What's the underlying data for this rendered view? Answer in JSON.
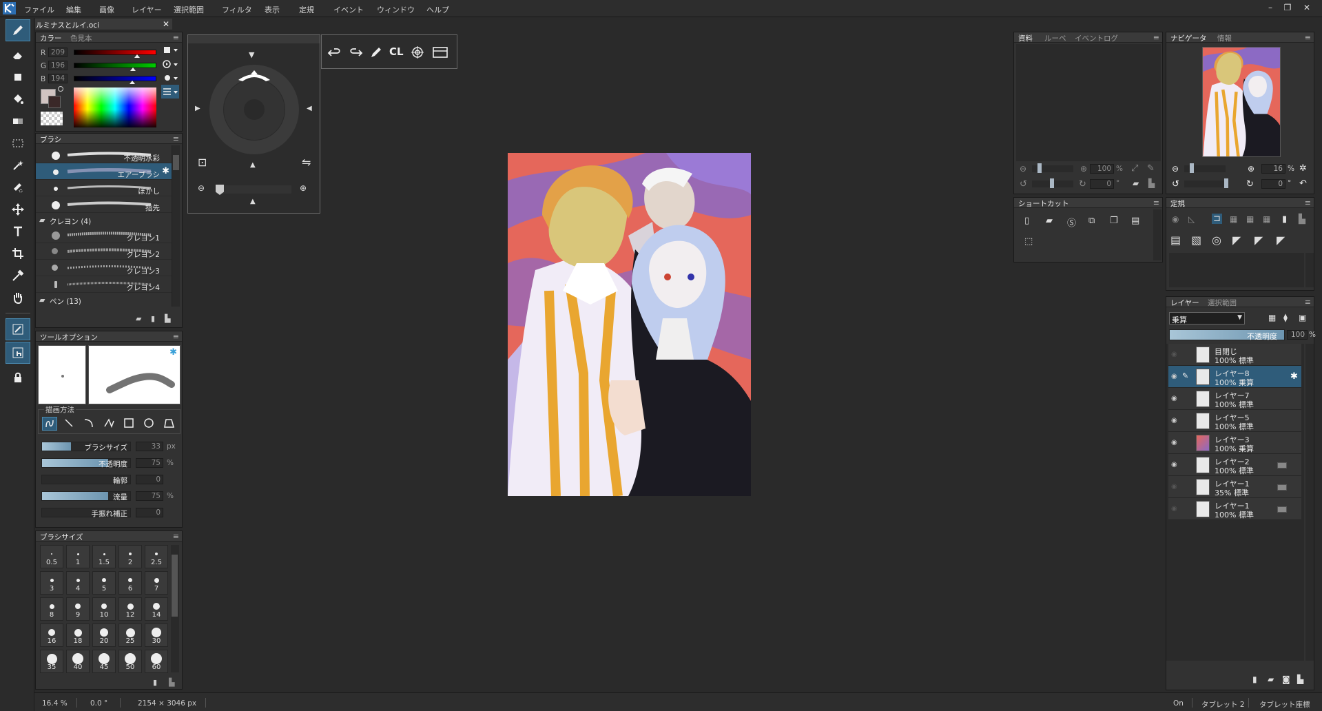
{
  "menu": [
    "ファイル",
    "編集",
    "画像",
    "レイヤー",
    "選択範囲",
    "フィルタ",
    "表示",
    "定規",
    "イベント",
    "ウィンドウ",
    "ヘルプ"
  ],
  "window_controls": [
    "–",
    "❐",
    "✕"
  ],
  "doc_tab": {
    "name": "ルミナスとルイ.oci",
    "close": "✕"
  },
  "color_panel": {
    "tabs": [
      "カラー",
      "色見本"
    ],
    "r_label": "R",
    "r_value": "209",
    "g_label": "G",
    "g_value": "196",
    "b_label": "B",
    "b_value": "194",
    "current_color": "#d1c4c2",
    "menu_glyph": "≡"
  },
  "brush_panel": {
    "title": "ブラシ",
    "items": [
      {
        "name": "不透明水彩"
      },
      {
        "name": "エアーブラシ"
      },
      {
        "name": "ぼかし"
      },
      {
        "name": "指先"
      }
    ],
    "group_crayon": "クレヨン (4)",
    "crayon_items": [
      {
        "name": "クレヨン1"
      },
      {
        "name": "クレヨン2"
      },
      {
        "name": "クレヨン3"
      },
      {
        "name": "クレヨン4"
      }
    ],
    "group_pen": "ペン (13)"
  },
  "tool_options": {
    "title": "ツールオプション",
    "draw_method_label": "描画方法",
    "brush_size_label": "ブラシサイズ",
    "brush_size_value": "33",
    "brush_size_unit": "px",
    "brush_size_level": 0.33,
    "opacity_label": "不透明度",
    "opacity_value": "75",
    "opacity_unit": "%",
    "opacity_level": 0.75,
    "outline_label": "輪郭",
    "outline_value": "0",
    "flow_label": "流量",
    "flow_value": "75",
    "flow_unit": "%",
    "flow_level": 0.75,
    "stabilizer_label": "手振れ補正",
    "stabilizer_value": "0"
  },
  "brush_size_panel": {
    "title": "ブラシサイズ",
    "sizes": [
      "0.5",
      "1",
      "1.5",
      "2",
      "2.5",
      "3",
      "4",
      "5",
      "6",
      "7",
      "8",
      "9",
      "10",
      "12",
      "14",
      "16",
      "18",
      "20",
      "25",
      "30",
      "35",
      "40",
      "45",
      "50",
      "60"
    ]
  },
  "quick_toolbar": {
    "cl_label": "CL"
  },
  "reference_panel": {
    "tabs": [
      "資料",
      "ルーペ",
      "イベントログ"
    ],
    "zoom_value": "100",
    "zoom_unit": "%",
    "rotate_value": "0",
    "rotate_unit": "°"
  },
  "navigator_panel": {
    "tabs": [
      "ナビゲータ",
      "情報"
    ],
    "zoom_value": "16",
    "zoom_unit": "%",
    "rotate_value": "0",
    "rotate_unit": "°"
  },
  "shortcut_panel": {
    "title": "ショートカット"
  },
  "ruler_panel": {
    "title": "定規"
  },
  "layer_panel": {
    "tabs": [
      "レイヤー",
      "選択範囲"
    ],
    "blend_mode": "乗算",
    "opacity_label": "不透明度",
    "opacity_value": "100",
    "opacity_unit": "%",
    "layers": [
      {
        "name": "目閉じ",
        "mode": "100% 標準"
      },
      {
        "name": "レイヤー8",
        "mode": "100% 乗算"
      },
      {
        "name": "レイヤー7",
        "mode": "100% 標準"
      },
      {
        "name": "レイヤー5",
        "mode": "100% 標準"
      },
      {
        "name": "レイヤー3",
        "mode": "100% 乗算"
      },
      {
        "name": "レイヤー2",
        "mode": "100% 標準"
      },
      {
        "name": "レイヤー1",
        "mode": " 35% 標準"
      },
      {
        "name": "レイヤー1",
        "mode": "100% 標準"
      }
    ]
  },
  "status": {
    "zoom": "16.4 %",
    "angle": "0.0 °",
    "size": "2154 × 3046 px",
    "on": "On",
    "tablet": "タブレット 2",
    "tablet_coords": "タブレット座標"
  },
  "colors": {
    "accent": "#2f5c7a",
    "panel_bg": "#323232",
    "canvas_bg": "#2a2a2a"
  }
}
